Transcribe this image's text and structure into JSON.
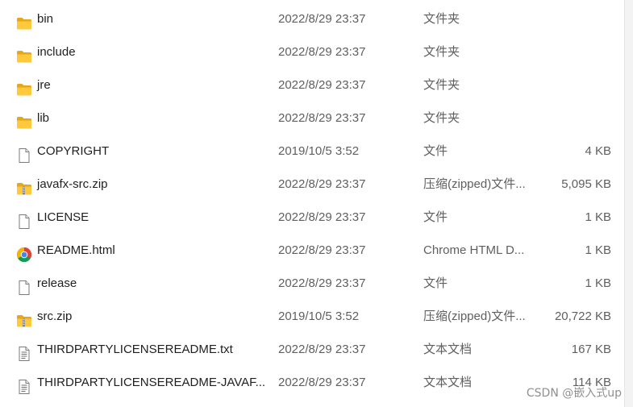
{
  "files": [
    {
      "name": "bin",
      "date": "2022/8/29 23:37",
      "type": "文件夹",
      "size": "",
      "icon": "folder-icon"
    },
    {
      "name": "include",
      "date": "2022/8/29 23:37",
      "type": "文件夹",
      "size": "",
      "icon": "folder-icon"
    },
    {
      "name": "jre",
      "date": "2022/8/29 23:37",
      "type": "文件夹",
      "size": "",
      "icon": "folder-icon"
    },
    {
      "name": "lib",
      "date": "2022/8/29 23:37",
      "type": "文件夹",
      "size": "",
      "icon": "folder-icon"
    },
    {
      "name": "COPYRIGHT",
      "date": "2019/10/5 3:52",
      "type": "文件",
      "size": "4 KB",
      "icon": "file-icon"
    },
    {
      "name": "javafx-src.zip",
      "date": "2022/8/29 23:37",
      "type": "压缩(zipped)文件...",
      "size": "5,095 KB",
      "icon": "zip-folder-icon"
    },
    {
      "name": "LICENSE",
      "date": "2022/8/29 23:37",
      "type": "文件",
      "size": "1 KB",
      "icon": "file-icon"
    },
    {
      "name": "README.html",
      "date": "2022/8/29 23:37",
      "type": "Chrome HTML D...",
      "size": "1 KB",
      "icon": "chrome-icon"
    },
    {
      "name": "release",
      "date": "2022/8/29 23:37",
      "type": "文件",
      "size": "1 KB",
      "icon": "file-icon"
    },
    {
      "name": "src.zip",
      "date": "2019/10/5 3:52",
      "type": "压缩(zipped)文件...",
      "size": "20,722 KB",
      "icon": "zip-folder-icon"
    },
    {
      "name": "THIRDPARTYLICENSEREADME.txt",
      "date": "2022/8/29 23:37",
      "type": "文本文档",
      "size": "167 KB",
      "icon": "text-document-icon"
    },
    {
      "name": "THIRDPARTYLICENSEREADME-JAVAF...",
      "date": "2022/8/29 23:37",
      "type": "文本文档",
      "size": "114 KB",
      "icon": "text-document-icon"
    }
  ],
  "watermark": "CSDN @嵌入式up",
  "colors": {
    "folder": "#ffc83d",
    "folder_dark": "#e6a817",
    "text": "#1f1f1f",
    "secondary_text": "#5f5f5f"
  }
}
